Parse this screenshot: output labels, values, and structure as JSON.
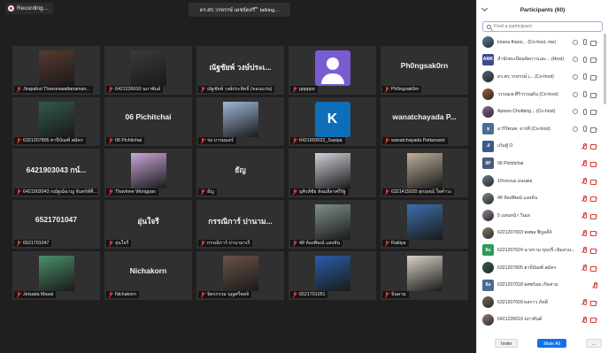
{
  "recording_label": "Recording...",
  "speaker_bar": "ดร.ศร.วรหรรษ์ เดชจัดสรี ิ ิ talking...",
  "tiles": [
    {
      "big": "",
      "label": "Jirapahut Thavorawattanaman...",
      "pic": "photo",
      "color": "#5a3a30"
    },
    {
      "big": "",
      "label": "6421226010 นภาพันธ์",
      "pic": "photo",
      "color": "#3a3a3a"
    },
    {
      "big": "ณัฐชัยพ์ วงษ์ประเ...",
      "label": "ณัฐชัยพ์ วงษ์ประสิทธิ์ (ขอนแก่น)",
      "pic": "none"
    },
    {
      "big": "",
      "label": "pppppo",
      "pic": "purple"
    },
    {
      "big": "Ph0ngsak0rn",
      "label": "Ph0ngsak0rn",
      "pic": "none"
    },
    {
      "big": "",
      "label": "6321207805 ฮาบีบัณฑ์ สมัคร",
      "pic": "photo",
      "color": "#2f5b4a"
    },
    {
      "big": "06 Pichitchai",
      "label": "06 Pichitchai",
      "pic": "none"
    },
    {
      "big": "",
      "label": "ร่อ บารมมอร์",
      "pic": "photo",
      "color": "#9fb7d6"
    },
    {
      "big": "",
      "label": "6421903022_Sasipa",
      "pic": "k",
      "letter": "K"
    },
    {
      "big": "wanatchayada P...",
      "label": "wanatchayada Pattanasiri",
      "pic": "none"
    },
    {
      "big": "6421903043 กน์...",
      "label": "6421903043 กณัฐณ์ฉาญ จันทร์ท์ที่...",
      "pic": "none"
    },
    {
      "big": "",
      "label": "Thavinee Wongpan",
      "pic": "photo",
      "color": "#c9a6d9"
    },
    {
      "big": "ธัญ",
      "label": "ธัญ",
      "pic": "none"
    },
    {
      "big": "",
      "label": "บุศิรส์ชัย ห้อมลีลาศรีรัฐ",
      "pic": "photo",
      "color": "#cfd2da"
    },
    {
      "big": "",
      "label": "6321415020 สุกฤษณ์ ใจคำวะ",
      "pic": "photo",
      "color": "#bfae9c"
    },
    {
      "big": "6521701047",
      "label": "6521701047",
      "pic": "none"
    },
    {
      "big": "อุ่นใจรี",
      "label": "อุ่นใจรี",
      "pic": "none"
    },
    {
      "big": "กรรณิการ์ ปานาม...",
      "label": "กรรณิการ์ ปานามาเรี",
      "pic": "none"
    },
    {
      "big": "",
      "label": "48 ห้องพิษณ์ แสงจัน",
      "pic": "photo",
      "color": "#7f8f88"
    },
    {
      "big": "",
      "label": "Rattiya",
      "pic": "photo",
      "color": "#3d6fb0"
    },
    {
      "big": "",
      "label": "Jetsada Masai",
      "pic": "photo",
      "color": "#4a8f6a"
    },
    {
      "big": "Nichakorn",
      "label": "Nichakorn",
      "pic": "none"
    },
    {
      "big": "",
      "label": "จิตรกรรม บุญศรีพลจิ",
      "pic": "photo",
      "color": "#6a5248"
    },
    {
      "big": "",
      "label": "6521701051",
      "pic": "photo",
      "color": "#2a5ea8"
    },
    {
      "big": "",
      "label": "จินดาม",
      "pic": "photo",
      "color": "#d9d2c4"
    }
  ],
  "panel": {
    "title": "Participants (60)",
    "search_placeholder": "Find a participant",
    "participants": [
      {
        "name": "kirana thano... (Co-host, me)",
        "avatar": "photo",
        "color": "#5b7fa8",
        "mic": "on",
        "cam": "on"
      },
      {
        "name": "สำนักทะเบียนจัดการและ... (Host)",
        "avatar": "text",
        "initials": "AMK",
        "color": "#3b4a8c",
        "mic": "on",
        "cam": "on"
      },
      {
        "name": "ดร.ศร.วรหรรษ์ เ... (Co-host)",
        "avatar": "photo",
        "color": "#506070",
        "mic": "on",
        "cam": "on"
      },
      {
        "name": "วรรณเพ ศิริวรรณผัน (Co-host)",
        "avatar": "photo",
        "color": "#a35a40",
        "mic": "on",
        "cam": "on"
      },
      {
        "name": "Apison Chotbing... (Co-host)",
        "avatar": "photo",
        "color": "#8a6a9a",
        "mic": "on",
        "cam": "on"
      },
      {
        "name": "อารีรัตนพ. จารที (Co-host)",
        "avatar": "text",
        "initials": "อ",
        "color": "#4a6f95",
        "mic": "on",
        "cam": "on"
      },
      {
        "name": "เก้นพู้ O",
        "avatar": "text",
        "initials": ".il",
        "color": "#3b5a8a",
        "mic": "off",
        "cam": "off"
      },
      {
        "name": "06 Pichitchai",
        "avatar": "text",
        "initials": "0P",
        "color": "#4a5a7a",
        "mic": "off",
        "cam": "off"
      },
      {
        "name": "10รหรบม ยนนตย",
        "avatar": "photo",
        "color": "#6f7d8c",
        "mic": "off",
        "cam": "off"
      },
      {
        "name": "48 ห้องพิษณ์ แสงจัน",
        "avatar": "photo",
        "color": "#7f8f88",
        "mic": "off",
        "cam": "off"
      },
      {
        "name": "5 แสนหน้า วินเผ",
        "avatar": "photo",
        "color": "#9a7fa0",
        "mic": "off",
        "cam": "off"
      },
      {
        "name": "6221207003 พลพล ฟิบูลคีจ้",
        "avatar": "photo",
        "color": "#8c7a6a",
        "mic": "off",
        "cam": "off"
      },
      {
        "name": "6221207024 นายราม ขุนปรี เข้มสวน...",
        "avatar": "text",
        "initials": "6u",
        "color": "#2f9a5a",
        "mic": "off",
        "cam": "off"
      },
      {
        "name": "6321207805 ฮาบีบัณฑ์ สมัคร",
        "avatar": "photo",
        "color": "#2f5b4a",
        "mic": "off",
        "cam": "off"
      },
      {
        "name": "6321207018 ยศพร้อม เกิดสาม",
        "avatar": "text",
        "initials": "6u",
        "color": "#4a6a9a",
        "mic": "off",
        "cam": "none"
      },
      {
        "name": "6321207009 ผลการ ภัคดี",
        "avatar": "photo",
        "color": "#7a6a58",
        "mic": "off",
        "cam": "off"
      },
      {
        "name": "6421226019 ปภาทันต์",
        "avatar": "photo",
        "color": "#9a8070",
        "mic": "off",
        "cam": "off"
      }
    ],
    "footer": {
      "invite": "Invite",
      "mute_all": "Mute All",
      "more": "..."
    }
  }
}
